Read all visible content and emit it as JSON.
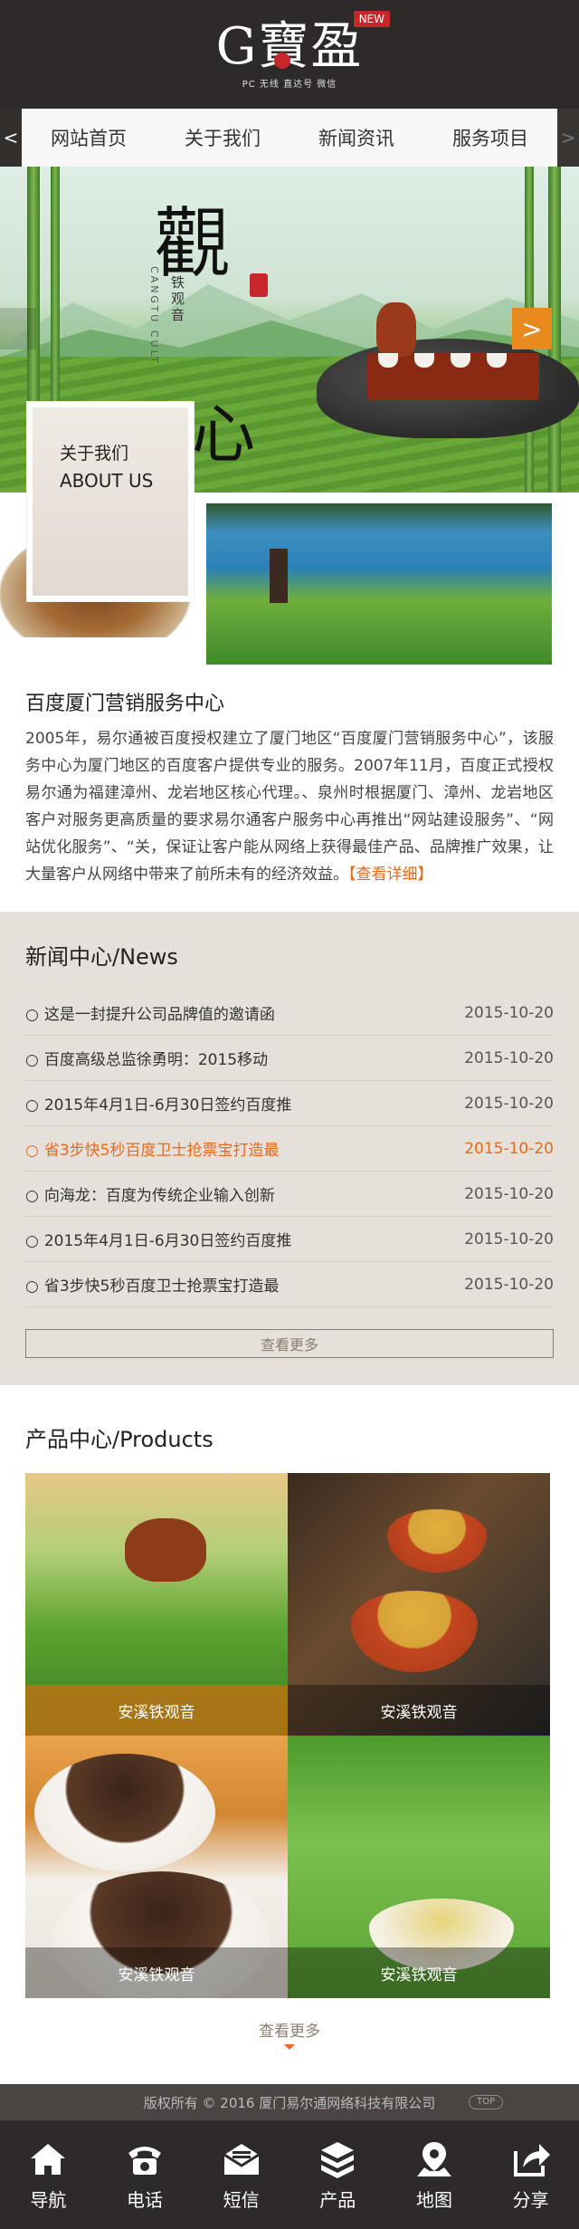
{
  "header": {
    "logo_text": "G寶盈",
    "logo_sub": "PC 无线 直达号 微信",
    "badge": "NEW"
  },
  "nav": {
    "prev": "<",
    "next": ">",
    "items": [
      {
        "label": "网站首页"
      },
      {
        "label": "关于我们"
      },
      {
        "label": "新闻资讯"
      },
      {
        "label": "服务项目"
      }
    ]
  },
  "banner": {
    "title_top": "觀",
    "title_bottom": "心",
    "subtitle": "铁观音",
    "pinyin": "CANGTU CULT",
    "next_arrow": ">"
  },
  "about": {
    "card_cn": "关于我们",
    "card_en": "ABOUT US",
    "title": "百度厦门营销服务中心",
    "text": "2005年，易尔通被百度授权建立了厦门地区“百度厦门营销服务中心”，该服务中心为厦门地区的百度客户提供专业的服务。2007年11月，百度正式授权易尔通为福建漳州、龙岩地区核心代理。、泉州时根据厦门、漳州、龙岩地区客户对服务更高质量的要求易尔通客户服务中心再推出“网站建设服务”、“网站优化服务”、“关，保证让客户能从网络上获得最佳产品、品牌推广效果，让大量客户从网络中带来了前所未有的经济效益。",
    "more": "【查看详细】"
  },
  "news": {
    "title": "新闻中心/News",
    "items": [
      {
        "title": "这是一封提升公司品牌值的邀请函",
        "date": "2015-10-20"
      },
      {
        "title": "百度高级总监徐勇明：2015移动",
        "date": "2015-10-20"
      },
      {
        "title": "2015年4月1日-6月30日签约百度推",
        "date": "2015-10-20"
      },
      {
        "title": "省3步快5秒百度卫士抢票宝打造最",
        "date": "2015-10-20"
      },
      {
        "title": "向海龙：百度为传统企业输入创新",
        "date": "2015-10-20"
      },
      {
        "title": "2015年4月1日-6月30日签约百度推",
        "date": "2015-10-20"
      },
      {
        "title": "省3步快5秒百度卫士抢票宝打造最",
        "date": "2015-10-20"
      }
    ],
    "bullet": "○",
    "more": "查看更多"
  },
  "products": {
    "title": "产品中心/Products",
    "items": [
      {
        "label": "安溪铁观音"
      },
      {
        "label": "安溪铁观音"
      },
      {
        "label": "安溪铁观音"
      },
      {
        "label": "安溪铁观音"
      }
    ],
    "more": "查看更多"
  },
  "footer": {
    "copyright": "版权所有 © 2016 厦门易尔通网络科技有限公司",
    "top": "TOP"
  },
  "bottom_bar": [
    {
      "label": "导航",
      "icon": "home-icon"
    },
    {
      "label": "电话",
      "icon": "phone-icon"
    },
    {
      "label": "短信",
      "icon": "mail-icon"
    },
    {
      "label": "产品",
      "icon": "box-icon"
    },
    {
      "label": "地图",
      "icon": "map-pin-icon"
    },
    {
      "label": "分享",
      "icon": "share-icon"
    }
  ],
  "colors": {
    "header_bg": "#2e2a29",
    "accent": "#e56a1c",
    "news_bg": "#e5e0d9",
    "badge": "#c8262b"
  }
}
